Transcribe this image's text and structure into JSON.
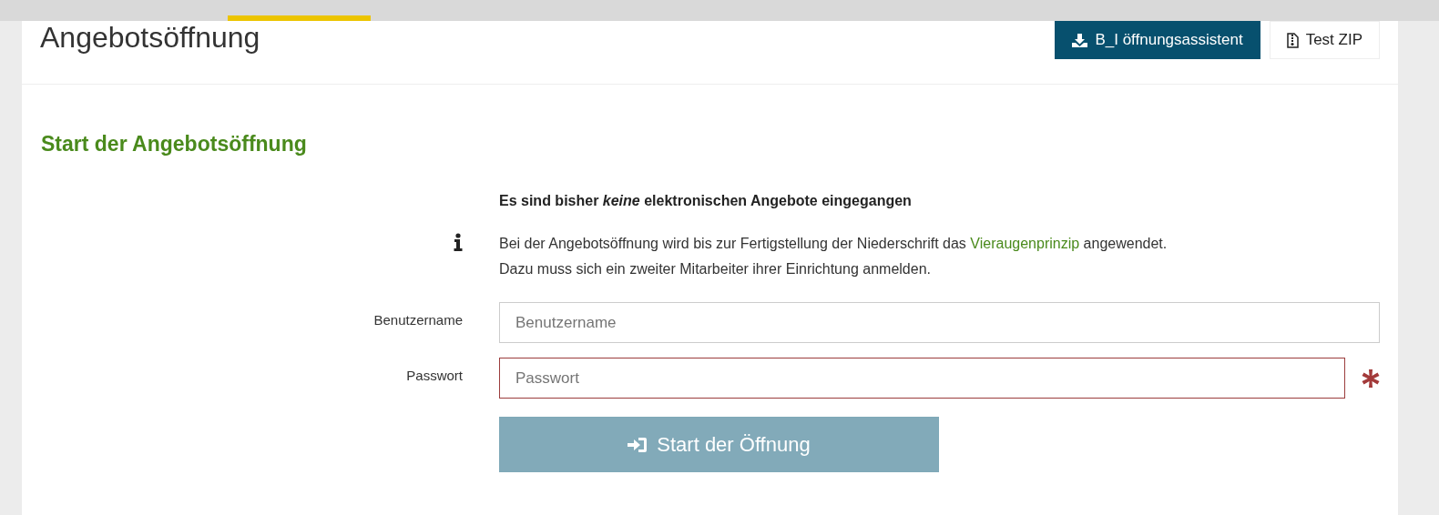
{
  "page": {
    "title": "Angebotsöffnung"
  },
  "header_buttons": [
    {
      "label": "B_I öffnungsassistent",
      "kind": "download",
      "primary": true
    },
    {
      "label": "Test ZIP",
      "kind": "zip",
      "primary": false
    }
  ],
  "section": {
    "heading": "Start der Angebotsöffnung"
  },
  "notice": "Es sind bisher *keine* elektronischen Angebote eingegangen",
  "info": {
    "text_before": "Bei der Angebotsöffnung wird bis zur Fertigstellung der Niederschrift das",
    "link": "Vieraugenprinzip",
    "text_after": "angewendet.",
    "line_2": "Dazu muss sich ein zweiter Mitarbeiter ihrer Einrichtung anmelden."
  },
  "fields": [
    {
      "label": "Benutzername",
      "placeholder": "Benutzername",
      "required": false,
      "invalid": false
    },
    {
      "label": "Passwort",
      "placeholder": "Passwort",
      "required": true,
      "invalid": true
    }
  ],
  "submit": {
    "label": "Start der Öffnung",
    "disabled": true
  }
}
